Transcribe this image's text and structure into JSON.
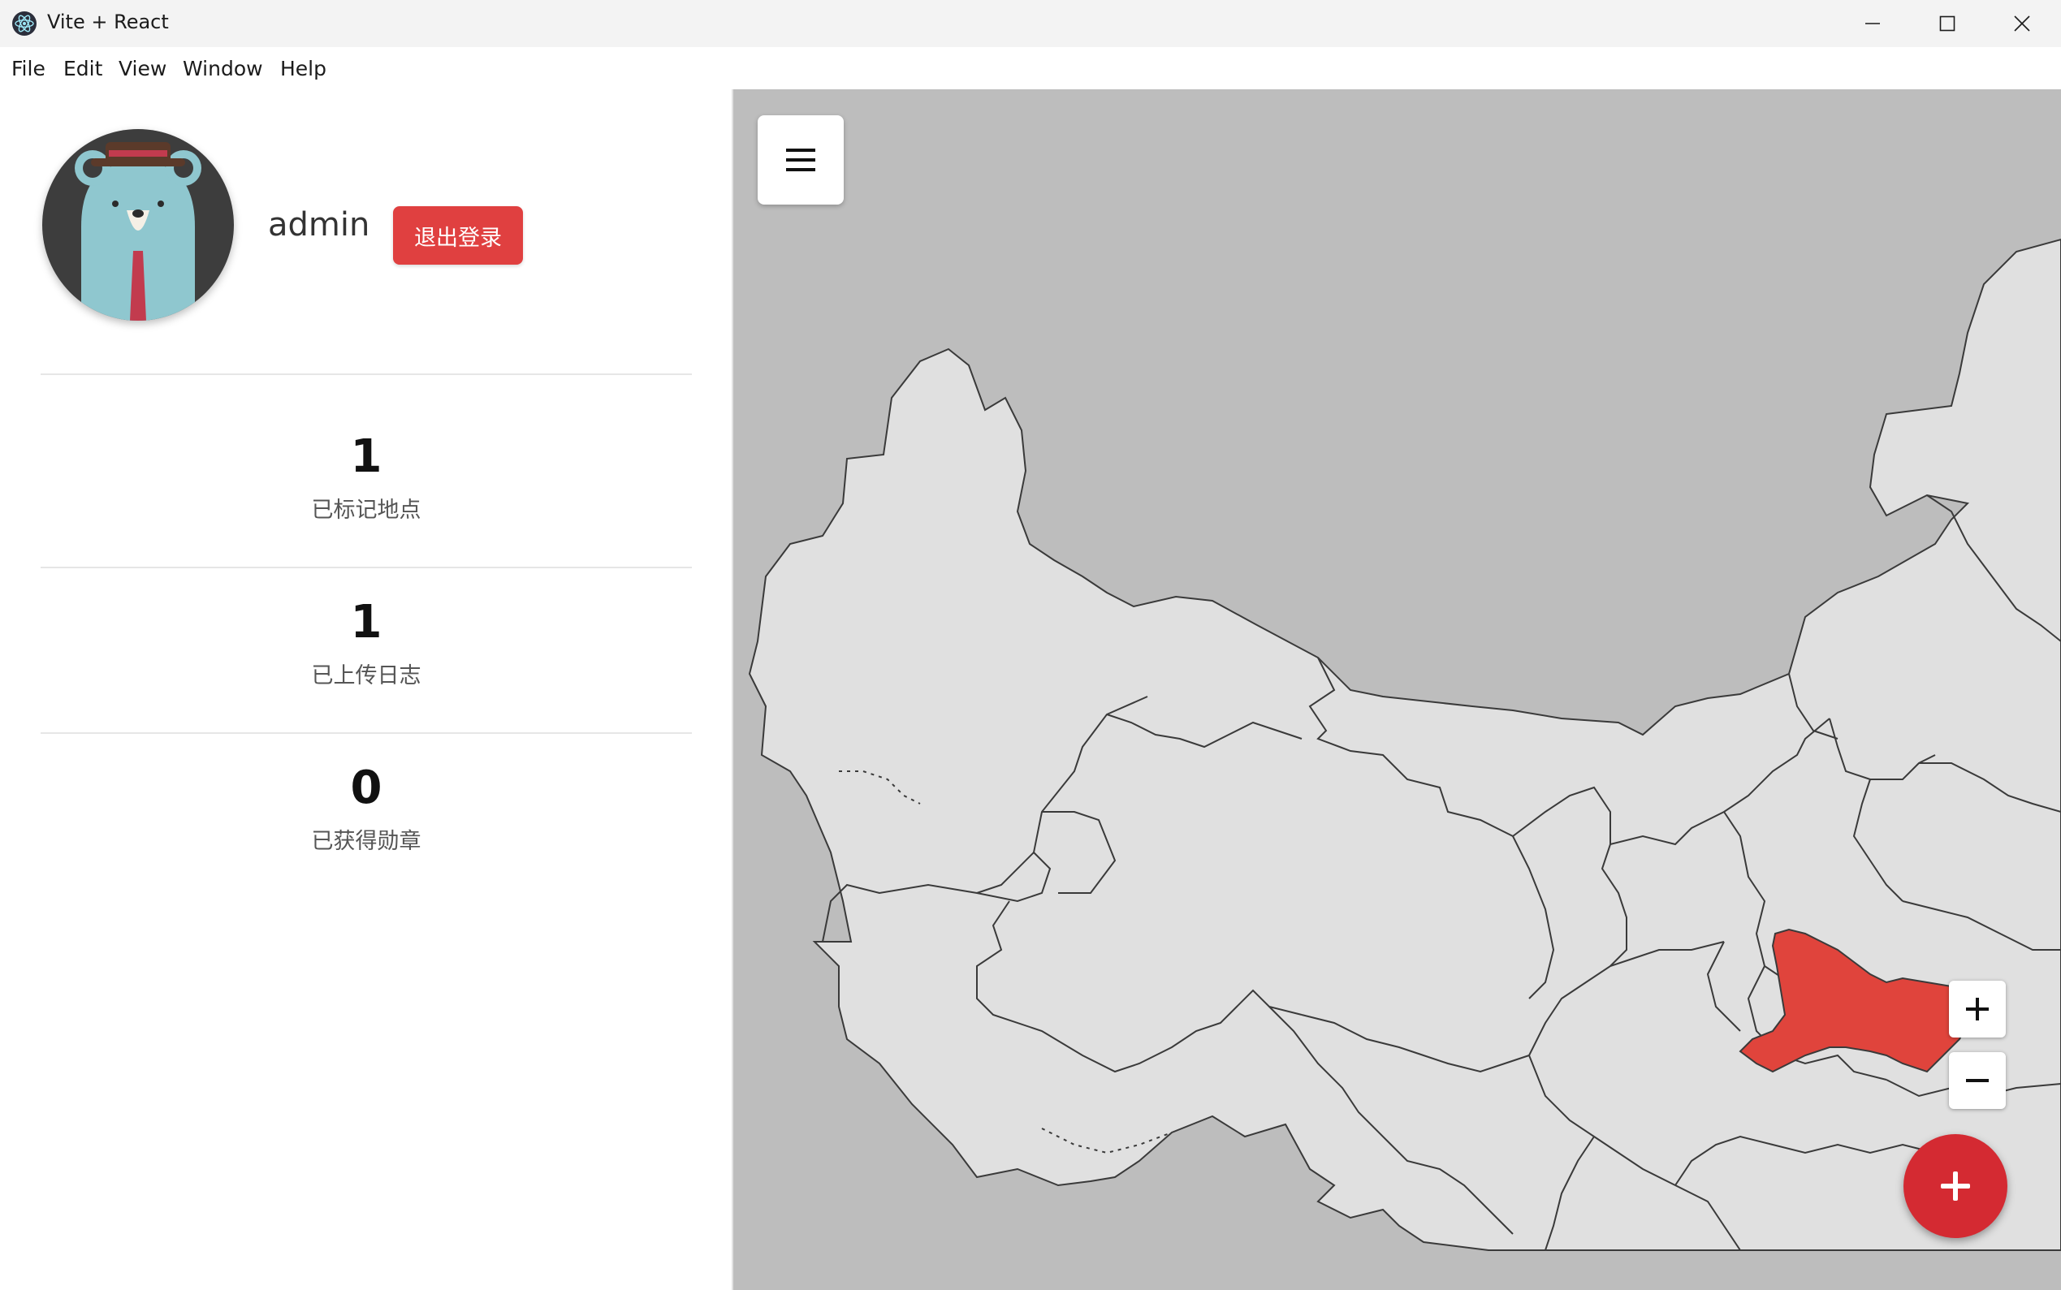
{
  "window": {
    "title": "Vite + React"
  },
  "menu": [
    {
      "label": "File"
    },
    {
      "label": "Edit"
    },
    {
      "label": "View"
    },
    {
      "label": "Window"
    },
    {
      "label": "Help"
    }
  ],
  "profile": {
    "username": "admin",
    "logout_label": "退出登录"
  },
  "stats": [
    {
      "value": "1",
      "label": "已标记地点"
    },
    {
      "value": "1",
      "label": "已上传日志"
    },
    {
      "value": "0",
      "label": "已获得勋章"
    }
  ],
  "map": {
    "land_color": "#e0e0e0",
    "water_color": "#bdbdbd",
    "highlight_color": "#e0443c",
    "toggle_icon": "hamburger-icon",
    "zoom_in_icon": "plus-icon",
    "zoom_out_icon": "minus-icon",
    "add_icon": "plus-icon"
  },
  "colors": {
    "accent_red": "#e04040",
    "fab_red": "#d42a32"
  }
}
